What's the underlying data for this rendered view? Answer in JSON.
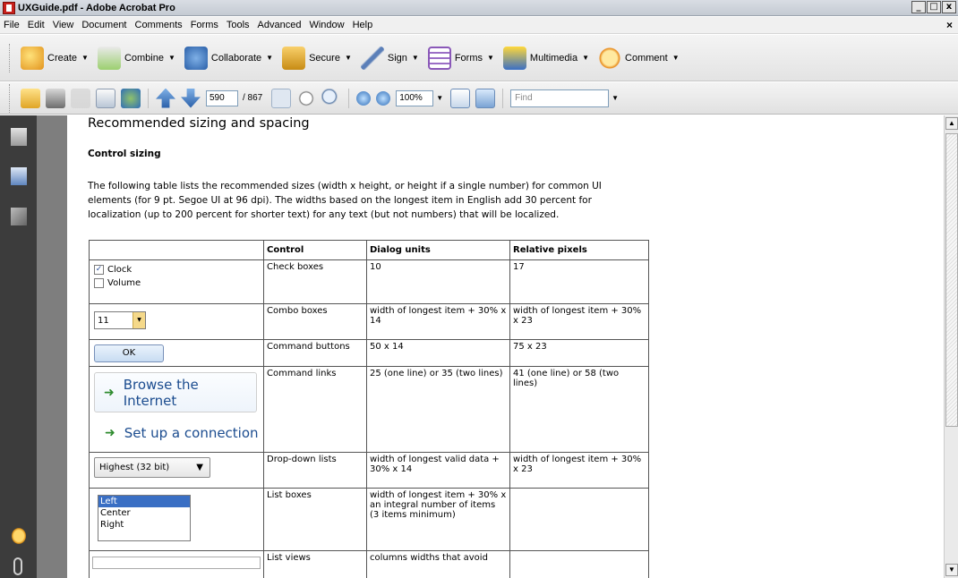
{
  "window": {
    "title": "UXGuide.pdf - Adobe Acrobat Pro",
    "close_glyph": "×"
  },
  "menu": [
    "File",
    "Edit",
    "View",
    "Document",
    "Comments",
    "Forms",
    "Tools",
    "Advanced",
    "Window",
    "Help"
  ],
  "tasks": [
    {
      "label": "Create",
      "icon": "create-icon"
    },
    {
      "label": "Combine",
      "icon": "combine-icon"
    },
    {
      "label": "Collaborate",
      "icon": "collaborate-icon"
    },
    {
      "label": "Secure",
      "icon": "lock-icon"
    },
    {
      "label": "Sign",
      "icon": "pen-icon"
    },
    {
      "label": "Forms",
      "icon": "forms-icon"
    },
    {
      "label": "Multimedia",
      "icon": "multimedia-icon"
    },
    {
      "label": "Comment",
      "icon": "comment-icon"
    }
  ],
  "toolbar": {
    "page": "590",
    "page_count": "/ 867",
    "zoom": "100%",
    "find_placeholder": "Find"
  },
  "document": {
    "heading": "Recommended sizing and spacing",
    "subheading": "Control sizing",
    "intro": "The following table lists the recommended sizes (width x height, or height if a single number) for common UI elements (for 9 pt. Segoe UI at 96 dpi). The widths based on the longest item in English add 30 percent for localization (up to 200 percent for shorter text) for any text (but not numbers) that will be localized.",
    "table": {
      "headers": [
        "",
        "Control",
        "Dialog units",
        "Relative pixels"
      ],
      "rows": [
        {
          "control": "Check boxes",
          "dialog": "10",
          "pixels": "17"
        },
        {
          "control": "Combo boxes",
          "dialog": "width of longest item + 30% x 14",
          "pixels": "width of longest item + 30% x 23"
        },
        {
          "control": "Command buttons",
          "dialog": "50 x 14",
          "pixels": "75 x 23"
        },
        {
          "control": "Command links",
          "dialog": "25 (one line) or 35 (two lines)",
          "pixels": "41 (one line) or 58 (two lines)"
        },
        {
          "control": "Drop-down lists",
          "dialog": "width of longest valid data + 30% x 14",
          "pixels": "width of longest item + 30% x 23"
        },
        {
          "control": "List boxes",
          "dialog": "width of longest item + 30% x an integral number of items (3 items minimum)",
          "pixels": ""
        },
        {
          "control": "List views",
          "dialog": "columns widths that avoid",
          "pixels": ""
        }
      ]
    },
    "samples": {
      "checkbox_clock": "Clock",
      "checkbox_volume": "Volume",
      "combo_value": "11",
      "ok_button": "OK",
      "link_browse": "Browse the Internet",
      "link_setup": "Set up a connection",
      "dropdown_value": "Highest (32 bit)",
      "listbox_items": [
        "Left",
        "Center",
        "Right"
      ]
    }
  }
}
